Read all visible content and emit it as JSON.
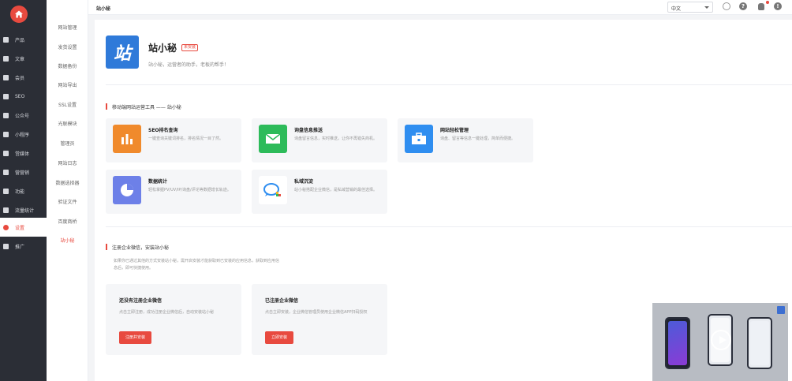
{
  "sidebar": {
    "items": [
      {
        "label": "产品"
      },
      {
        "label": "文章"
      },
      {
        "label": "会员"
      },
      {
        "label": "SEO"
      },
      {
        "label": "公众号"
      },
      {
        "label": "小程序"
      },
      {
        "label": "営媒体"
      },
      {
        "label": "营营销"
      },
      {
        "label": "功能"
      },
      {
        "label": "流量统计"
      },
      {
        "label": "设置"
      },
      {
        "label": "推广"
      }
    ],
    "active_color": "#e84a3f"
  },
  "submenu": {
    "items": [
      {
        "label": "网站管理"
      },
      {
        "label": "发货设置"
      },
      {
        "label": "数据备份"
      },
      {
        "label": "网站导出"
      },
      {
        "label": "SSL设置"
      },
      {
        "label": "光联模块"
      },
      {
        "label": "管理员"
      },
      {
        "label": "网站日志"
      },
      {
        "label": "数据选择器"
      },
      {
        "label": "验证文件"
      },
      {
        "label": "百度商桥"
      },
      {
        "label": "站小秘"
      }
    ]
  },
  "topbar": {
    "breadcrumb": "站小秘",
    "language": "中文"
  },
  "app": {
    "logo_text": "站",
    "title": "站小秘",
    "tag": "未安装",
    "subtitle": "站小秘，运营者的助手，老板的帮手！"
  },
  "tools_section": {
    "title": "移动端网站运营工具 —— 站小秘",
    "tools": [
      {
        "name": "SEO排名查询",
        "desc": "一键查询关键词排名，排名情况一目了然。",
        "color": "#f08a2c",
        "icon": "bar-chart-icon"
      },
      {
        "name": "询盘信息推送",
        "desc": "询盘留言信息，实时推送，让你不再错失商机。",
        "color": "#2dbb5a",
        "icon": "mail-icon"
      },
      {
        "name": "网站轻松管理",
        "desc": "询盘、留言等信息一键处理，简单而便捷。",
        "color": "#2f8ef0",
        "icon": "briefcase-icon"
      },
      {
        "name": "数据统计",
        "desc": "轻松掌握PV/UV/IP/询盘/评论等数据增长轨迹。",
        "color": "#6d80e8",
        "icon": "pie-chart-icon"
      },
      {
        "name": "私域沉淀",
        "desc": "站小秘搭配企业微信，是私域营销的最佳选择。",
        "color": "#ffffff",
        "icon": "chat-bubble-icon"
      }
    ]
  },
  "register_section": {
    "title": "注册企业微信，安装站小秘",
    "desc": "如果你已通过其他的方式安装站小秘，需开启安装才能获取到已安装的应用信息，获取到应用信息后，即可快捷使用。",
    "cards": [
      {
        "title": "还没有注册企业微信",
        "desc": "点击立即注册，成功注册企业微信后，自动安装站小秘",
        "button": "注册并安装"
      },
      {
        "title": "已注册企业微信",
        "desc": "点击立即安装，企业微信管理员使用企业微信APP扫码授权",
        "button": "立即安装"
      }
    ]
  }
}
